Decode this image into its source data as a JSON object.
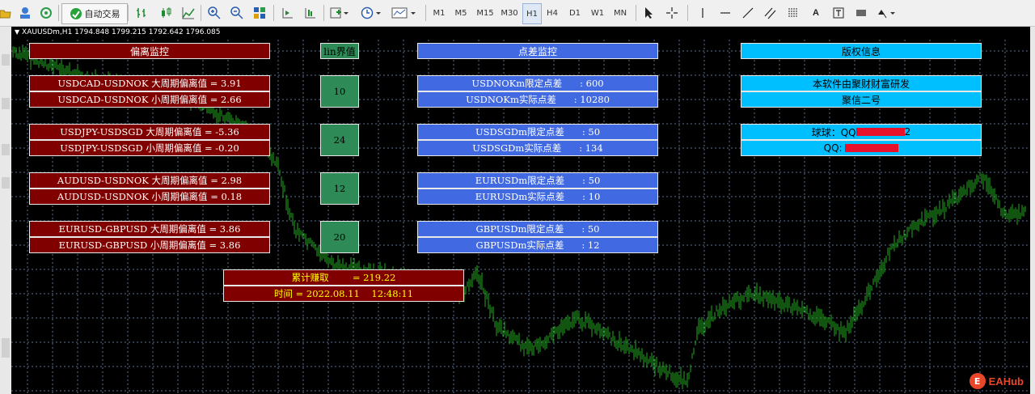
{
  "toolbar": {
    "auto_trade_label": "自动交易",
    "timeframes": [
      "M1",
      "M5",
      "M15",
      "M30",
      "H1",
      "H4",
      "D1",
      "W1",
      "MN"
    ],
    "active_timeframe": "H1",
    "text_tool": "A"
  },
  "chart": {
    "symbol_header": "XAUUSDm,H1  1794.848 1799.215 1792.642 1796.085",
    "candle_color": "#22aa22",
    "grid_color": "#5a7090"
  },
  "deviation": {
    "header": "偏离监控",
    "rows": [
      {
        "big": "USDCAD-USDNOK 大周期偏离值 = 3.91",
        "small": "USDCAD-USDNOK 小周期偏离值 = 2.66"
      },
      {
        "big": "USDJPY-USDSGD 大周期偏离值 = -5.36",
        "small": "USDJPY-USDSGD 小周期偏离值 = -0.20"
      },
      {
        "big": "AUDUSD-USDNOK 大周期偏离值 = 2.98",
        "small": "AUDUSD-USDNOK 小周期偏离值 = 0.18"
      },
      {
        "big": "EURUSD-GBPUSD 大周期偏离值 = 3.86",
        "small": "EURUSD-GBPUSD 小周期偏离值 = 3.86"
      }
    ]
  },
  "threshold": {
    "header": "lin界值",
    "values": [
      "10",
      "24",
      "12",
      "20"
    ]
  },
  "spread": {
    "header": "点差监控",
    "rows": [
      {
        "limit": "USDNOKm限定点差      : 600",
        "actual": "USDNOKm实际点差      : 10280"
      },
      {
        "limit": "USDSGDm限定点差      : 50",
        "actual": "USDSGDm实际点差      : 134"
      },
      {
        "limit": "EURUSDm限定点差      : 50",
        "actual": "EURUSDm实际点差      : 10"
      },
      {
        "limit": "GBPUSDm限定点差      : 50",
        "actual": "GBPUSDm实际点差      : 12"
      }
    ]
  },
  "copyright": {
    "header": "版权信息",
    "line1": "本软件由聚财财富研发",
    "line2": "聚信二号",
    "qq_group_label": "球球：QQ",
    "qq_group_tail": "2",
    "qq_label": "QQ: "
  },
  "summary": {
    "profit": "累计赚取        = 219.22",
    "time": "时间 = 2022.08.11    12:48:11"
  },
  "watermark": "EAHub",
  "watermark_logo": "E"
}
